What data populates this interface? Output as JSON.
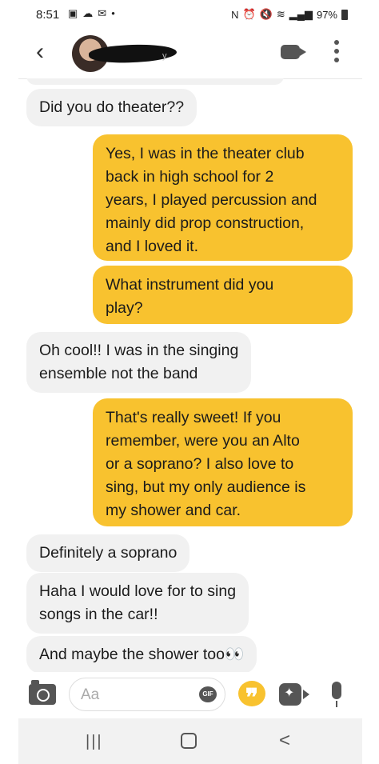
{
  "status_bar": {
    "time": "8:51",
    "battery": "97%",
    "left_icons": [
      "gallery-icon",
      "cloud-icon",
      "mail-icon",
      "dot-icon"
    ],
    "right_icons": [
      "nfc-icon",
      "alarm-icon",
      "mute-icon",
      "wifi-icon",
      "signal-icon",
      "battery-icon"
    ]
  },
  "header": {
    "back_icon": "chevron-left-icon",
    "contact_name_suffix": "y",
    "video_icon": "video-camera-icon",
    "menu_icon": "kebab-menu-icon"
  },
  "messages": [
    {
      "dir": "in",
      "text": "Did you do theater??"
    },
    {
      "dir": "out",
      "text": "Yes, I was in the theater club\nback in high school for 2\nyears, I played percussion and\nmainly did prop construction,\nand I loved it."
    },
    {
      "dir": "out",
      "text": "What instrument did you\nplay?"
    },
    {
      "dir": "in",
      "text": "Oh cool!! I was in the singing\nensemble not the band"
    },
    {
      "dir": "out",
      "text": "That's really sweet! If you\nremember,  were you an Alto\nor a soprano? I also love to\nsing, but my only audience is\nmy shower and car."
    },
    {
      "dir": "in",
      "text": "Definitely a soprano"
    },
    {
      "dir": "in",
      "text": "Haha I would love for to sing\nsongs in the car!!"
    },
    {
      "dir": "in",
      "text": "And maybe the shower too👀"
    }
  ],
  "composer": {
    "placeholder": "Aa",
    "gif_label": "GIF",
    "quote_glyph": "❞",
    "icons": [
      "camera-icon",
      "gif-icon",
      "quote-icon",
      "game-icon",
      "microphone-icon"
    ]
  },
  "nav": {
    "recent_glyph": "|||",
    "back_glyph": "<"
  },
  "colors": {
    "outgoing_bubble": "#f8c22f",
    "incoming_bubble": "#f1f1f1",
    "accent": "#f8c22f"
  }
}
